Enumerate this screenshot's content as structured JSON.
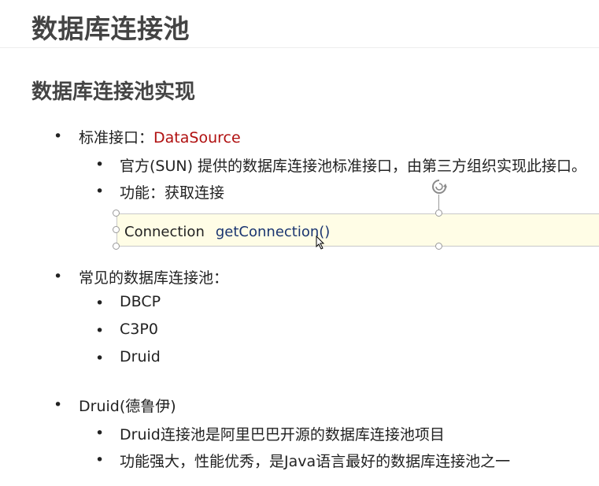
{
  "slide": {
    "title": "数据库连接池",
    "subtitle": "数据库连接池实现",
    "bullet1": {
      "label": "标准接口：",
      "highlight": "DataSource",
      "subitems": [
        "官方(SUN) 提供的数据库连接池标准接口，由第三方组织实现此接口。",
        "功能：获取连接"
      ]
    },
    "code": {
      "type": "Connection",
      "method": "getConnection()"
    },
    "bullet2": {
      "label": "常见的数据库连接池：",
      "subitems": [
        "DBCP",
        "C3P0",
        "Druid"
      ]
    },
    "bullet3": {
      "label": "Druid(德鲁伊)",
      "subitems": [
        "Druid连接池是阿里巴巴开源的数据库连接池项目",
        "功能强大，性能优秀，是Java语言最好的数据库连接池之一"
      ]
    },
    "bullet_glyph": "•"
  }
}
